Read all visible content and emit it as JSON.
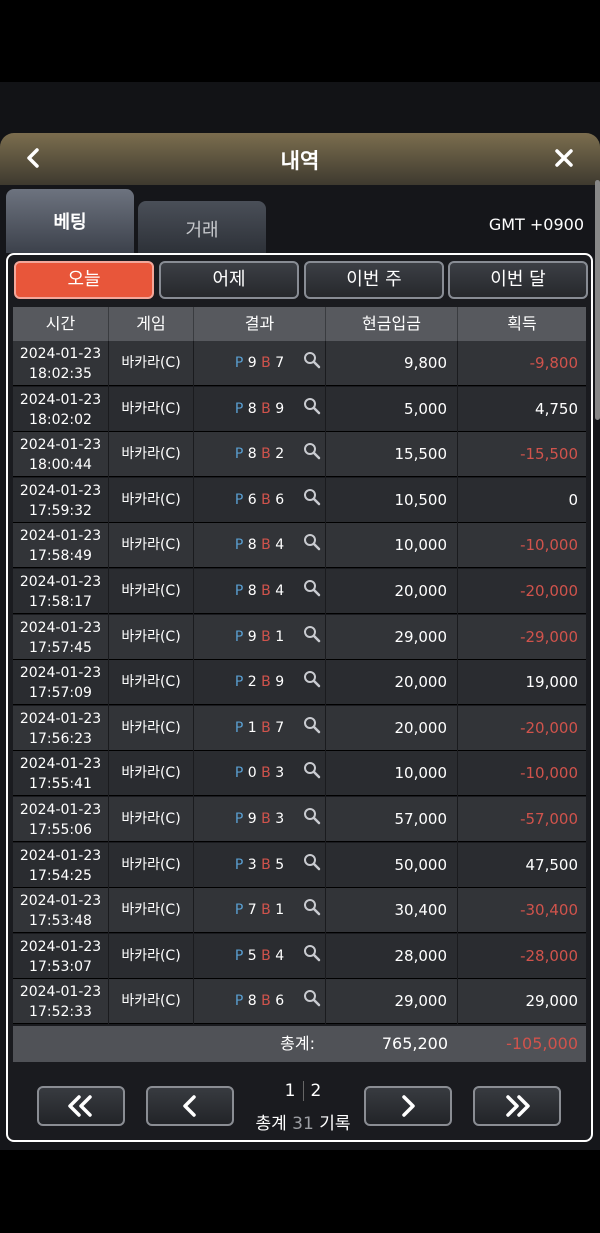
{
  "header": {
    "title": "내역"
  },
  "tabs": [
    {
      "label": "베팅"
    },
    {
      "label": "거래"
    }
  ],
  "timezone": "GMT +0900",
  "filters": [
    {
      "label": "오늘",
      "active": true
    },
    {
      "label": "어제"
    },
    {
      "label": "이번 주"
    },
    {
      "label": "이번 달"
    }
  ],
  "table": {
    "columns": [
      "시간",
      "게임",
      "결과",
      "현금입금",
      "획득"
    ],
    "rows": [
      {
        "date": "2024-01-23",
        "time": "18:02:35",
        "game": "바카라(C)",
        "p": "9",
        "b": "7",
        "bet": "9,800",
        "win": "-9,800"
      },
      {
        "date": "2024-01-23",
        "time": "18:02:02",
        "game": "바카라(C)",
        "p": "8",
        "b": "9",
        "bet": "5,000",
        "win": "4,750"
      },
      {
        "date": "2024-01-23",
        "time": "18:00:44",
        "game": "바카라(C)",
        "p": "8",
        "b": "2",
        "bet": "15,500",
        "win": "-15,500"
      },
      {
        "date": "2024-01-23",
        "time": "17:59:32",
        "game": "바카라(C)",
        "p": "6",
        "b": "6",
        "bet": "10,500",
        "win": "0"
      },
      {
        "date": "2024-01-23",
        "time": "17:58:49",
        "game": "바카라(C)",
        "p": "8",
        "b": "4",
        "bet": "10,000",
        "win": "-10,000"
      },
      {
        "date": "2024-01-23",
        "time": "17:58:17",
        "game": "바카라(C)",
        "p": "8",
        "b": "4",
        "bet": "20,000",
        "win": "-20,000"
      },
      {
        "date": "2024-01-23",
        "time": "17:57:45",
        "game": "바카라(C)",
        "p": "9",
        "b": "1",
        "bet": "29,000",
        "win": "-29,000"
      },
      {
        "date": "2024-01-23",
        "time": "17:57:09",
        "game": "바카라(C)",
        "p": "2",
        "b": "9",
        "bet": "20,000",
        "win": "19,000"
      },
      {
        "date": "2024-01-23",
        "time": "17:56:23",
        "game": "바카라(C)",
        "p": "1",
        "b": "7",
        "bet": "20,000",
        "win": "-20,000"
      },
      {
        "date": "2024-01-23",
        "time": "17:55:41",
        "game": "바카라(C)",
        "p": "0",
        "b": "3",
        "bet": "10,000",
        "win": "-10,000"
      },
      {
        "date": "2024-01-23",
        "time": "17:55:06",
        "game": "바카라(C)",
        "p": "9",
        "b": "3",
        "bet": "57,000",
        "win": "-57,000"
      },
      {
        "date": "2024-01-23",
        "time": "17:54:25",
        "game": "바카라(C)",
        "p": "3",
        "b": "5",
        "bet": "50,000",
        "win": "47,500"
      },
      {
        "date": "2024-01-23",
        "time": "17:53:48",
        "game": "바카라(C)",
        "p": "7",
        "b": "1",
        "bet": "30,400",
        "win": "-30,400"
      },
      {
        "date": "2024-01-23",
        "time": "17:53:07",
        "game": "바카라(C)",
        "p": "5",
        "b": "4",
        "bet": "28,000",
        "win": "-28,000"
      },
      {
        "date": "2024-01-23",
        "time": "17:52:33",
        "game": "바카라(C)",
        "p": "8",
        "b": "6",
        "bet": "29,000",
        "win": "29,000"
      }
    ],
    "p_letter": "P",
    "b_letter": "B"
  },
  "totals": {
    "label": "총계:",
    "bet": "765,200",
    "win": "-105,000"
  },
  "pagination": {
    "pages": [
      "1",
      "2"
    ],
    "summary_prefix": "총계",
    "count": "31",
    "summary_suffix": "기록"
  },
  "colors": {
    "accent": "#e8563a",
    "negative": "#d0534c",
    "player": "#5a9fd1"
  },
  "icons": {
    "back": "chevron-left-icon",
    "close": "close-icon",
    "detail": "magnifier-icon"
  }
}
